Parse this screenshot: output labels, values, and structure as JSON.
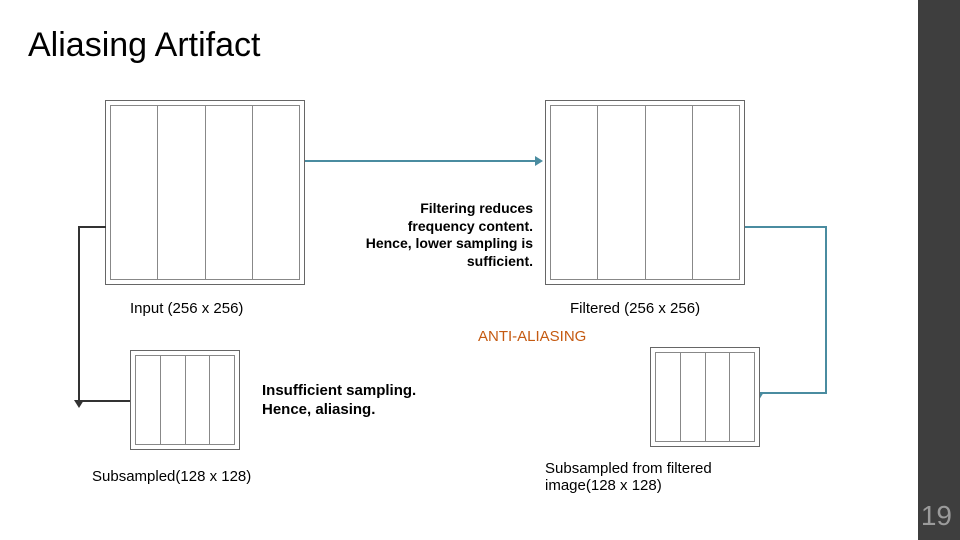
{
  "title": "Aliasing Artifact",
  "pageNumber": "19",
  "midText": "Filtering reduces\nfrequency content.\nHence, lower sampling is\nsufficient.",
  "captions": {
    "input": "Input (256 x 256)",
    "filtered": "Filtered (256 x 256)",
    "subsampled": "Subsampled(128 x 128)",
    "subsampledFiltered": "Subsampled from filtered\nimage(128 x 128)"
  },
  "antiAliasLabel": "ANTI-ALIASING",
  "insufficientText": "Insufficient sampling.\nHence, aliasing."
}
